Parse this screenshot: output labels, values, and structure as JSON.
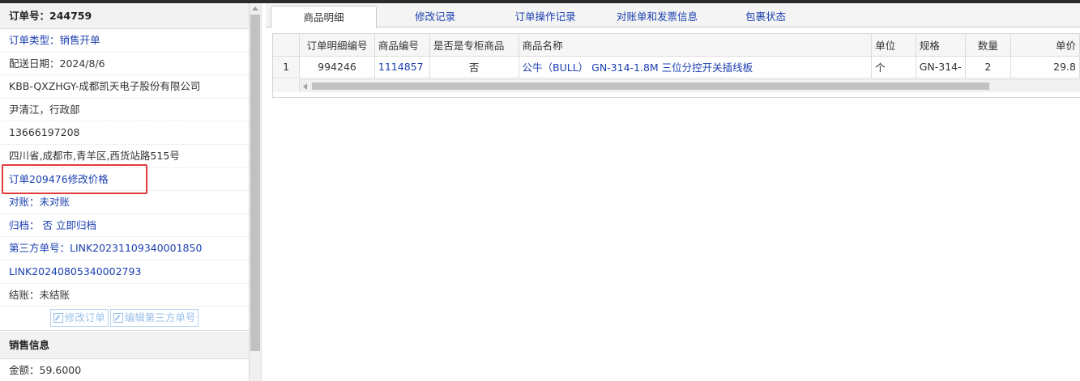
{
  "order": {
    "number_label": "订单号：244759",
    "rows": [
      {
        "text": "订单类型：销售开单",
        "style": "blue"
      },
      {
        "text": "配送日期：2024/8/6",
        "style": "normal"
      },
      {
        "text": "KBB-QXZHGY-成都凯天电子股份有限公司",
        "style": "normal"
      },
      {
        "text": "尹清江，行政部",
        "style": "normal"
      },
      {
        "text": "13666197208",
        "style": "normal"
      },
      {
        "text": "四川省,成都市,青羊区,西货站路515号",
        "style": "normal"
      },
      {
        "text": "订单209476修改价格",
        "style": "blue"
      },
      {
        "text": "对账：未对账",
        "style": "blue"
      },
      {
        "text": "归档： 否 立即归档",
        "style": "blue"
      },
      {
        "text": "第三方单号：LINK20231109340001850",
        "style": "blue"
      },
      {
        "text": "LINK20240805340002793",
        "style": "blue"
      },
      {
        "text": "结账：未结账",
        "style": "normal"
      }
    ],
    "edit_order_button": "修改订单",
    "edit_third_party_button": "编辑第三方单号"
  },
  "sales": {
    "header": "销售信息",
    "amount": "金额：59.6000"
  },
  "tabs": [
    {
      "label": "商品明细",
      "active": true
    },
    {
      "label": "修改记录",
      "active": false
    },
    {
      "label": "订单操作记录",
      "active": false
    },
    {
      "label": "对账单和发票信息",
      "active": false
    },
    {
      "label": "包裹状态",
      "active": false
    }
  ],
  "table": {
    "columns": [
      "",
      "订单明细编号",
      "商品编号",
      "是否是专柜商品",
      "商品名称",
      "单位",
      "规格",
      "数量",
      "单价"
    ],
    "rows": [
      [
        "1",
        "994246",
        "1114857",
        "否",
        "公牛（BULL） GN-314-1.8M 三位分控开关插线板",
        "个",
        "GN-314-",
        "2",
        "29.8"
      ]
    ]
  },
  "colors": {
    "link": "#1a3fb0",
    "highlight_box": "#e23b3b",
    "disabled_button": "#9ac0ea"
  }
}
